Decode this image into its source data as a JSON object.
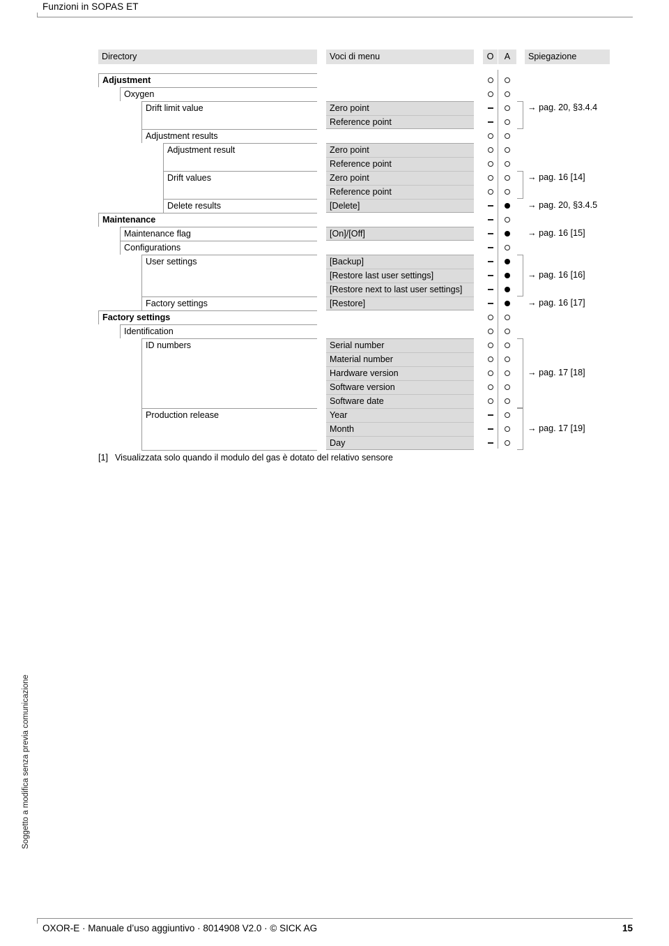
{
  "header": {
    "running_title": "Funzioni in SOPAS ET"
  },
  "side_note": "Soggetto a modifica senza previa comunicazione",
  "footer": {
    "left": "OXOR-E  ·  Manuale d’uso aggiuntivo  ·  8014908  V2.0  ·  © SICK AG",
    "page_number": "15"
  },
  "table": {
    "columns": {
      "directory": "Directory",
      "menu_items": "Voci di menu",
      "o": "O",
      "a": "A",
      "explanation": "Spiegazione"
    },
    "rows": [
      {
        "directory": "Adjustment",
        "level": 0,
        "bold": true,
        "menu": "",
        "o": "ring",
        "a": "ring",
        "expl": ""
      },
      {
        "directory": "Oxygen",
        "level": 1,
        "bold": false,
        "menu": "",
        "o": "ring",
        "a": "ring",
        "expl": ""
      },
      {
        "directory": "Drift limit value",
        "level": 2,
        "bold": false,
        "menu": "Zero point",
        "o": "dash",
        "a": "ring",
        "expl": "→ pag. 20, §3.4.4"
      },
      {
        "directory": "",
        "level": 2,
        "bold": false,
        "menu": "Reference point",
        "o": "dash",
        "a": "ring",
        "expl": ""
      },
      {
        "directory": "Adjustment results",
        "level": 2,
        "bold": false,
        "menu": "",
        "o": "ring",
        "a": "ring",
        "expl": ""
      },
      {
        "directory": "Adjustment result",
        "level": 3,
        "bold": false,
        "menu": "Zero point",
        "o": "ring",
        "a": "ring",
        "expl": ""
      },
      {
        "directory": "",
        "level": 3,
        "bold": false,
        "menu": "Reference point",
        "o": "ring",
        "a": "ring",
        "expl": ""
      },
      {
        "directory": "Drift values",
        "level": 3,
        "bold": false,
        "menu": "Zero point",
        "o": "ring",
        "a": "ring",
        "expl": "→ pag. 16 [14]"
      },
      {
        "directory": "",
        "level": 3,
        "bold": false,
        "menu": "Reference point",
        "o": "ring",
        "a": "ring",
        "expl": ""
      },
      {
        "directory": "Delete results",
        "level": 3,
        "bold": false,
        "menu": "[Delete]",
        "o": "dash",
        "a": "dot",
        "expl": "→ pag. 20, §3.4.5"
      },
      {
        "directory": "Maintenance",
        "level": 0,
        "bold": true,
        "menu": "",
        "o": "dash",
        "a": "ring",
        "expl": ""
      },
      {
        "directory": "Maintenance flag",
        "level": 1,
        "bold": false,
        "menu": "[On]/[Off]",
        "o": "dash",
        "a": "dot",
        "expl": "→ pag. 16 [15]"
      },
      {
        "directory": "Configurations",
        "level": 1,
        "bold": false,
        "menu": "",
        "o": "dash",
        "a": "ring",
        "expl": ""
      },
      {
        "directory": "User settings",
        "level": 2,
        "bold": false,
        "menu": "[Backup]",
        "o": "dash",
        "a": "dot",
        "expl": ""
      },
      {
        "directory": "",
        "level": 2,
        "bold": false,
        "menu": "[Restore last user settings]",
        "o": "dash",
        "a": "dot",
        "expl": "→ pag. 16 [16]"
      },
      {
        "directory": "",
        "level": 2,
        "bold": false,
        "menu": "[Restore next to last user settings]",
        "o": "dash",
        "a": "dot",
        "expl": ""
      },
      {
        "directory": "Factory settings",
        "level": 2,
        "bold": false,
        "menu": "[Restore]",
        "o": "dash",
        "a": "dot",
        "expl": "→ pag. 16 [17]"
      },
      {
        "directory": "Factory settings",
        "level": 0,
        "bold": true,
        "menu": "",
        "o": "ring",
        "a": "ring",
        "expl": ""
      },
      {
        "directory": "Identification",
        "level": 1,
        "bold": false,
        "menu": "",
        "o": "ring",
        "a": "ring",
        "expl": ""
      },
      {
        "directory": "ID numbers",
        "level": 2,
        "bold": false,
        "menu": "Serial number",
        "o": "ring",
        "a": "ring",
        "expl": ""
      },
      {
        "directory": "",
        "level": 2,
        "bold": false,
        "menu": "Material number",
        "o": "ring",
        "a": "ring",
        "expl": ""
      },
      {
        "directory": "",
        "level": 2,
        "bold": false,
        "menu": "Hardware version",
        "o": "ring",
        "a": "ring",
        "expl": "→ pag. 17 [18]"
      },
      {
        "directory": "",
        "level": 2,
        "bold": false,
        "menu": "Software version",
        "o": "ring",
        "a": "ring",
        "expl": ""
      },
      {
        "directory": "",
        "level": 2,
        "bold": false,
        "menu": "Software date",
        "o": "ring",
        "a": "ring",
        "expl": ""
      },
      {
        "directory": "Production release",
        "level": 2,
        "bold": false,
        "menu": "Year",
        "o": "dash",
        "a": "ring",
        "expl": ""
      },
      {
        "directory": "",
        "level": 2,
        "bold": false,
        "menu": "Month",
        "o": "dash",
        "a": "ring",
        "expl": "→ pag. 17 [19]"
      },
      {
        "directory": "",
        "level": 2,
        "bold": false,
        "menu": "Day",
        "o": "dash",
        "a": "ring",
        "expl": ""
      }
    ]
  },
  "footnote": {
    "marker": "[1]",
    "text": "Visualizzata solo quando il modulo del gas è dotato del relativo sensore"
  }
}
